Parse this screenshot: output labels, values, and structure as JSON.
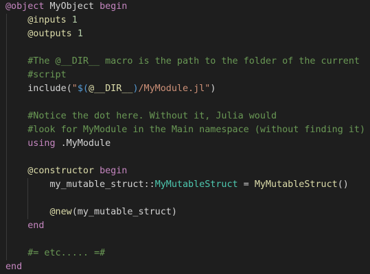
{
  "code": {
    "l1": {
      "kw1": "@object",
      "name": "MyObject",
      "kw2": "begin"
    },
    "l2": {
      "indent": "    ",
      "mac": "@inputs",
      "num": "1"
    },
    "l3": {
      "indent": "    ",
      "mac": "@outputs",
      "num": "1"
    },
    "l5": {
      "indent": "    ",
      "com": "#The @__DIR__ macro is the path to the folder of the current"
    },
    "l6": {
      "indent": "    ",
      "com": "#script"
    },
    "l7": {
      "indent": "    ",
      "fn": "include",
      "p1": "(",
      "s1": "\"",
      "s2": "$(",
      "m": "@__DIR__",
      "s3": ")",
      "s4": "/MyModule.jl\"",
      "p2": ")"
    },
    "l9": {
      "indent": "    ",
      "com": "#Notice the dot here. Without it, Julia would"
    },
    "l10": {
      "indent": "    ",
      "com": "#look for MyModule in the Main namespace (without finding it)"
    },
    "l11": {
      "indent": "    ",
      "kw": "using",
      "mod": " .MyModule"
    },
    "l13": {
      "indent": "    ",
      "mac": "@constructor",
      "kw": "begin"
    },
    "l14": {
      "indent": "        ",
      "id": "my_mutable_struct",
      "op": "::",
      "typ": "MyMutableStruct",
      "eq": " = ",
      "fn": "MyMutableStruct",
      "p": "()"
    },
    "l16": {
      "indent": "        ",
      "mac": "@new",
      "args": "(my_mutable_struct)"
    },
    "l17": {
      "indent": "    ",
      "kw": "end"
    },
    "l19": {
      "indent": "    ",
      "com": "#= etc..... =#"
    },
    "l20": {
      "kw": "end"
    }
  },
  "colors": {
    "background": "#1e1e1e",
    "keyword": "#c586c0",
    "macro": "#dcdcaa",
    "comment": "#6a9955",
    "string": "#ce9178",
    "type": "#4ec9b0",
    "number": "#b5cea8"
  }
}
